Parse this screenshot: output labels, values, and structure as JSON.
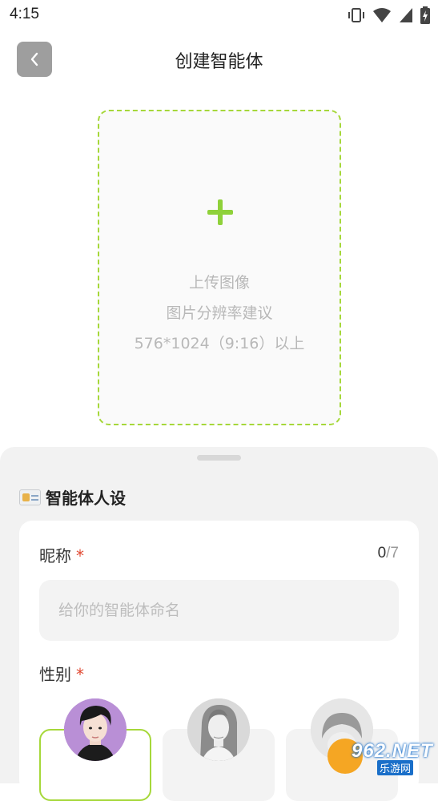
{
  "status_bar": {
    "time": "4:15"
  },
  "header": {
    "title": "创建智能体"
  },
  "upload": {
    "line1": "上传图像",
    "line2": "图片分辨率建议",
    "line3": "576*1024（9:16）以上"
  },
  "persona_section": {
    "title": "智能体人设"
  },
  "nickname": {
    "label": "昵称",
    "required_mark": "*",
    "count": "0",
    "max": "/7",
    "placeholder": "给你的智能体命名",
    "value": ""
  },
  "gender": {
    "label": "性别",
    "required_mark": "*"
  },
  "watermark": {
    "main": "962.NET",
    "sub": "乐游网"
  },
  "colors": {
    "accent": "#a6d83a",
    "required": "#e0462f"
  }
}
